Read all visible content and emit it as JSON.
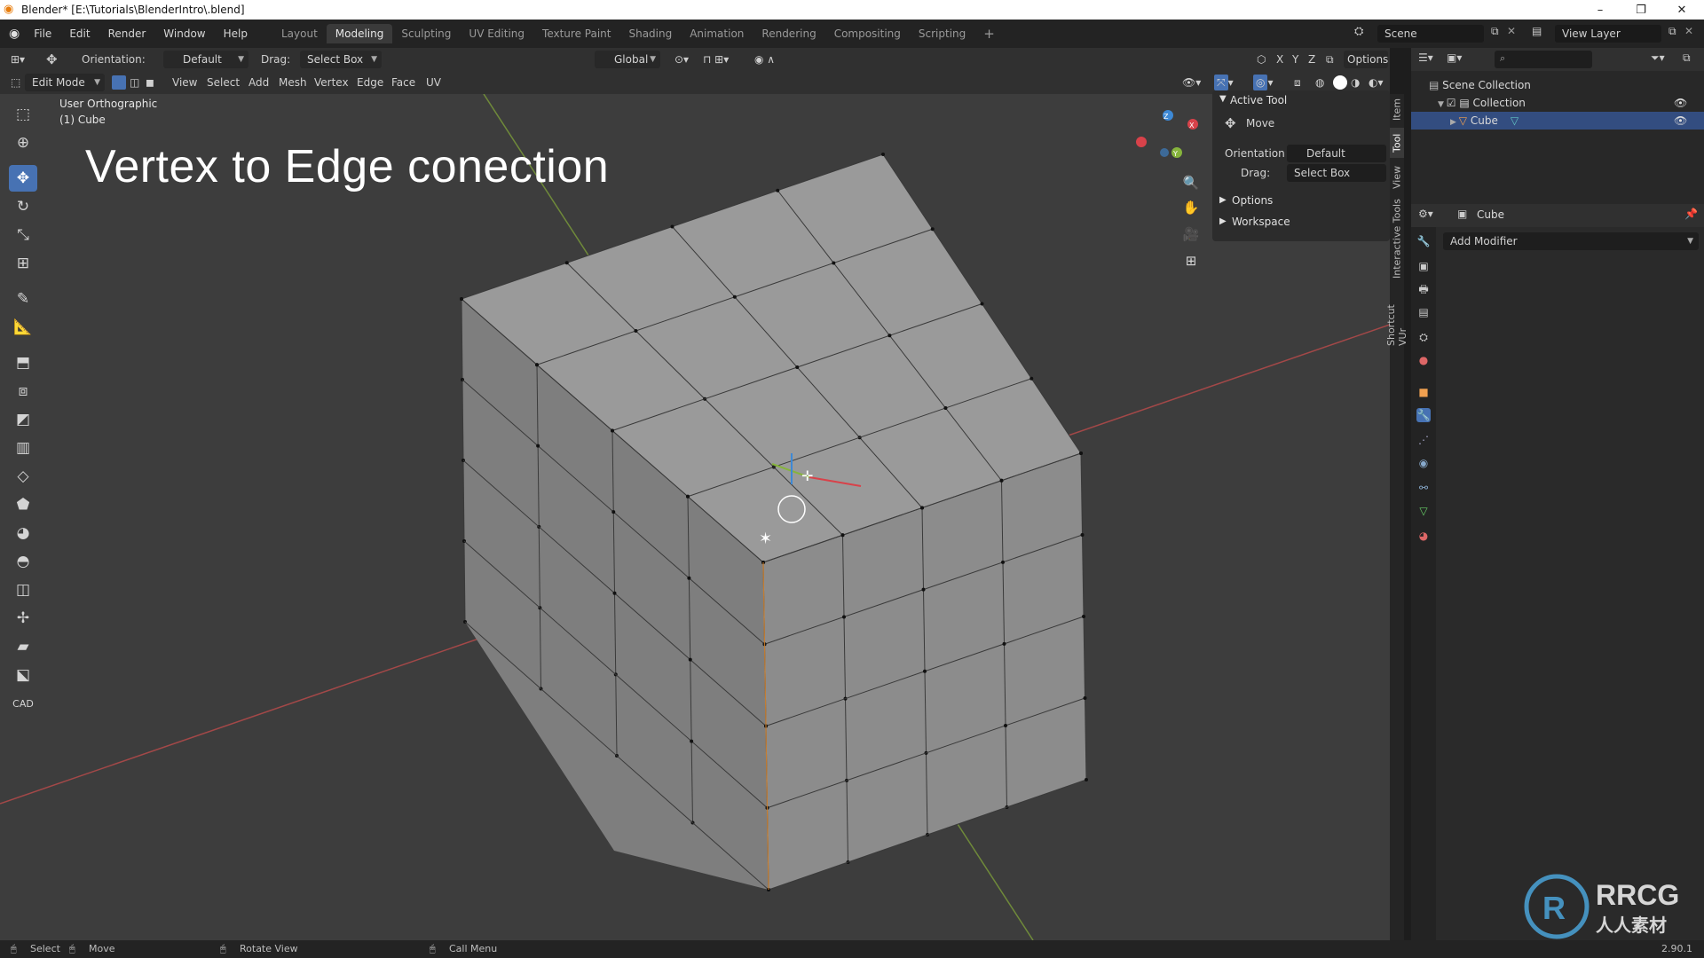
{
  "window": {
    "title": "Blender* [E:\\Tutorials\\BlenderIntro\\.blend]",
    "controls": [
      "–",
      "❐",
      "✕"
    ]
  },
  "menu": [
    "File",
    "Edit",
    "Render",
    "Window",
    "Help"
  ],
  "workspaces": {
    "tabs": [
      "Layout",
      "Modeling",
      "Sculpting",
      "UV Editing",
      "Texture Paint",
      "Shading",
      "Animation",
      "Rendering",
      "Compositing",
      "Scripting"
    ],
    "active": "Modeling",
    "add": "+"
  },
  "scene": {
    "name": "Scene",
    "view_layer": "View Layer"
  },
  "tool_header": {
    "orientation_label": "Orientation:",
    "orientation_value": "Default",
    "drag_label": "Drag:",
    "drag_value": "Select Box",
    "transform_space": "Global",
    "axes": [
      "X",
      "Y",
      "Z"
    ],
    "options": "Options"
  },
  "viewport_header": {
    "mode": "Edit Mode",
    "menus": [
      "View",
      "Select",
      "Add",
      "Mesh",
      "Vertex",
      "Edge",
      "Face",
      "UV"
    ]
  },
  "viewport": {
    "view_name": "User Orthographic",
    "object_label": "(1) Cube",
    "overlay_title": "Vertex to Edge conection"
  },
  "gizmo": {
    "x": "X",
    "y": "Y",
    "z": "Z"
  },
  "colors": {
    "accent": "#4772b3",
    "x_axis": "#d8424a",
    "y_axis": "#86b43c",
    "z_axis": "#3d89d6",
    "selection": "#ff9a2e"
  },
  "npanel": {
    "active_tool": "Active Tool",
    "tool_name": "Move",
    "orientation_label": "Orientation",
    "orientation_value": "Default",
    "drag_label": "Drag:",
    "drag_value": "Select Box",
    "sections": [
      "Options",
      "Workspace"
    ],
    "tabs": [
      "Item",
      "Tool",
      "View",
      "Interactive Tools",
      "Shortcut VUr"
    ]
  },
  "outliner": {
    "root": "Scene Collection",
    "collection": "Collection",
    "object": "Cube"
  },
  "properties": {
    "object_name": "Cube",
    "add_modifier": "Add Modifier"
  },
  "statusbar": {
    "select": "Select",
    "move": "Move",
    "rotate": "Rotate View",
    "call_menu": "Call Menu",
    "version": "2.90.1"
  },
  "watermark": {
    "logo": "RRCG",
    "subtitle": "人人素材"
  }
}
